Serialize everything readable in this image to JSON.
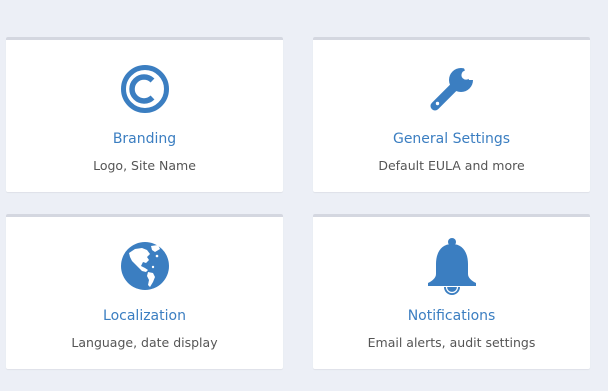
{
  "accent_color": "#3b7ec1",
  "cards": [
    {
      "title": "Branding",
      "description": "Logo, Site Name",
      "icon": "copyright-icon"
    },
    {
      "title": "General Settings",
      "description": "Default EULA and more",
      "icon": "wrench-icon"
    },
    {
      "title": "Localization",
      "description": "Language, date display",
      "icon": "globe-icon"
    },
    {
      "title": "Notifications",
      "description": "Email alerts, audit settings",
      "icon": "bell-icon"
    }
  ]
}
